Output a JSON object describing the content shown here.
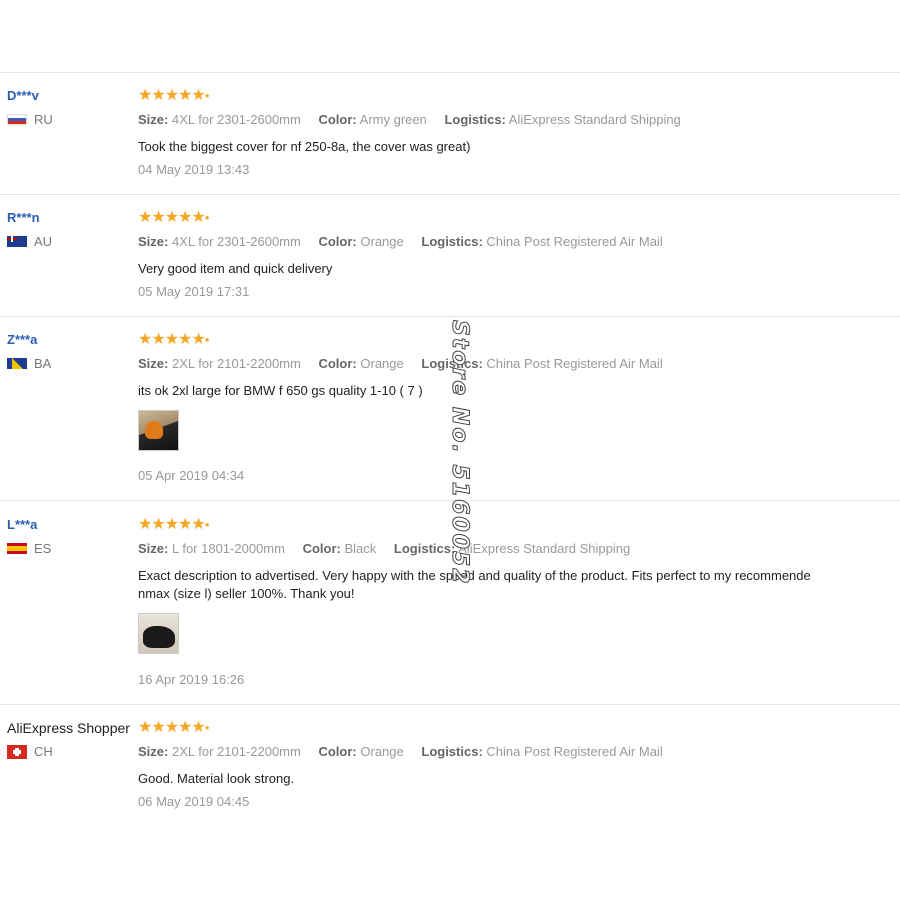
{
  "labels": {
    "size": "Size:",
    "color": "Color:",
    "logistics": "Logistics:"
  },
  "stars_glyph": "★★★★★",
  "reviews": [
    {
      "buyer": "D***v",
      "country": "RU",
      "flag": "flag-ru",
      "size": "4XL for 2301-2600mm",
      "color": "Army green",
      "logistics": "AliExpress Standard Shipping",
      "text": "Took the biggest cover for nf 250-8a, the cover was great)",
      "date": "04 May 2019 13:43"
    },
    {
      "buyer": "R***n",
      "country": "AU",
      "flag": "flag-au",
      "size": "4XL for 2301-2600mm",
      "color": "Orange",
      "logistics": "China Post Registered Air Mail",
      "text": "Very good item and quick delivery",
      "date": "05 May 2019 17:31"
    },
    {
      "buyer": "Z***a",
      "country": "BA",
      "flag": "flag-ba",
      "size": "2XL for 2101-2200mm",
      "color": "Orange",
      "logistics": "China Post Registered Air Mail",
      "text": "its ok 2xl large for BMW f 650 gs quality 1-10 ( 7 )",
      "date": "05 Apr 2019 04:34"
    },
    {
      "buyer": "L***a",
      "country": "ES",
      "flag": "flag-es",
      "size": "L for 1801-2000mm",
      "color": "Black",
      "logistics": "AliExpress Standard Shipping",
      "text_line1": "Exact description to advertised. Very happy with the speed and quality of the product. Fits perfect to my recommende",
      "text_line2": "nmax (size l) seller 100%. Thank you!",
      "date": "16 Apr 2019 16:26"
    },
    {
      "buyer": "AliExpress Shopper",
      "country": "CH",
      "flag": "flag-ch",
      "size": "2XL for 2101-2200mm",
      "color": "Orange",
      "logistics": "China Post Registered Air Mail",
      "text": "Good. Material look strong.",
      "date": "06 May 2019 04:45"
    }
  ],
  "watermark": "Store No. 5160052"
}
